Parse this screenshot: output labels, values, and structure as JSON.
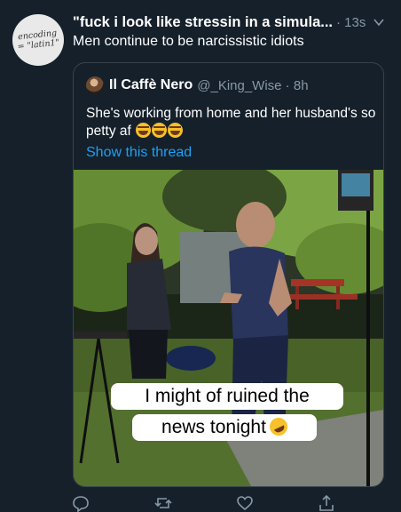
{
  "tweet": {
    "avatar_text": "encoding\n= \"latin1\"",
    "author_name": "\"fuck i look like stressin in a simula...",
    "timestamp": "· 13s",
    "text": "Men continue to be narcissistic idiots"
  },
  "quote": {
    "name": "Il Caffè Nero",
    "handle": "@_King_Wise · 8h",
    "text": "She's working from home and her husband's so petty af",
    "show_thread": "Show this thread",
    "caption_line1": "I might of ruined the",
    "caption_line2": "news tonight"
  },
  "colors": {
    "background": "#15202b",
    "link": "#1da1f2",
    "muted": "#8899a6",
    "border": "#38444d"
  },
  "icons": [
    "chevron-down-icon",
    "reply-icon",
    "retweet-icon",
    "like-icon",
    "share-icon",
    "tears-of-joy-emoji",
    "rolling-on-floor-laughing-emoji"
  ]
}
